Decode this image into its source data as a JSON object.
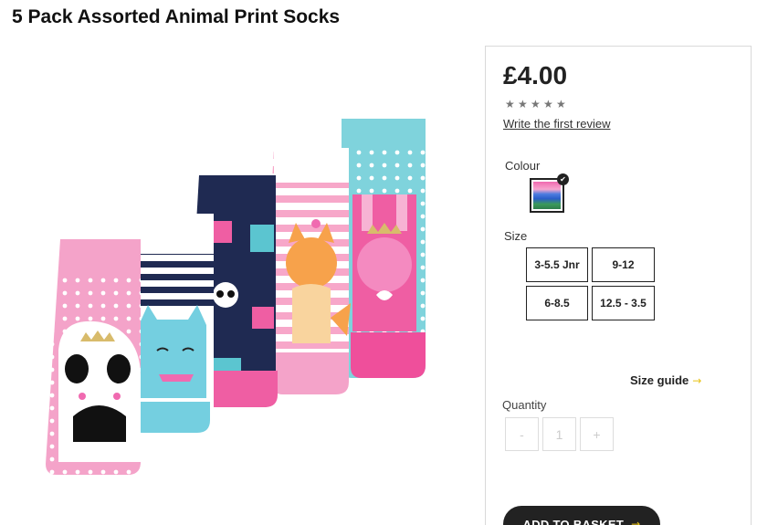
{
  "product": {
    "title": "5 Pack Assorted Animal Print Socks"
  },
  "purchase": {
    "price": "£4.00",
    "rating": {
      "stars": 5,
      "filled": 0
    },
    "review_link": "Write the first review",
    "colour_label": "Colour",
    "colour_swatch": {
      "selected": true,
      "colors": [
        "#f06ab0",
        "#4d7de0",
        "#3b9a5a"
      ]
    },
    "size_label": "Size",
    "sizes": [
      "3-5.5 Jnr",
      "9-12",
      "6-8.5",
      "12.5 - 3.5"
    ],
    "size_guide": "Size guide",
    "quantity_label": "Quantity",
    "quantity": {
      "minus": "-",
      "value": "1",
      "plus": "+"
    },
    "add_to_basket": "ADD TO BASKET"
  },
  "icons": {
    "arrow": "arrow-right-icon",
    "check": "check-icon",
    "star": "star-icon"
  }
}
